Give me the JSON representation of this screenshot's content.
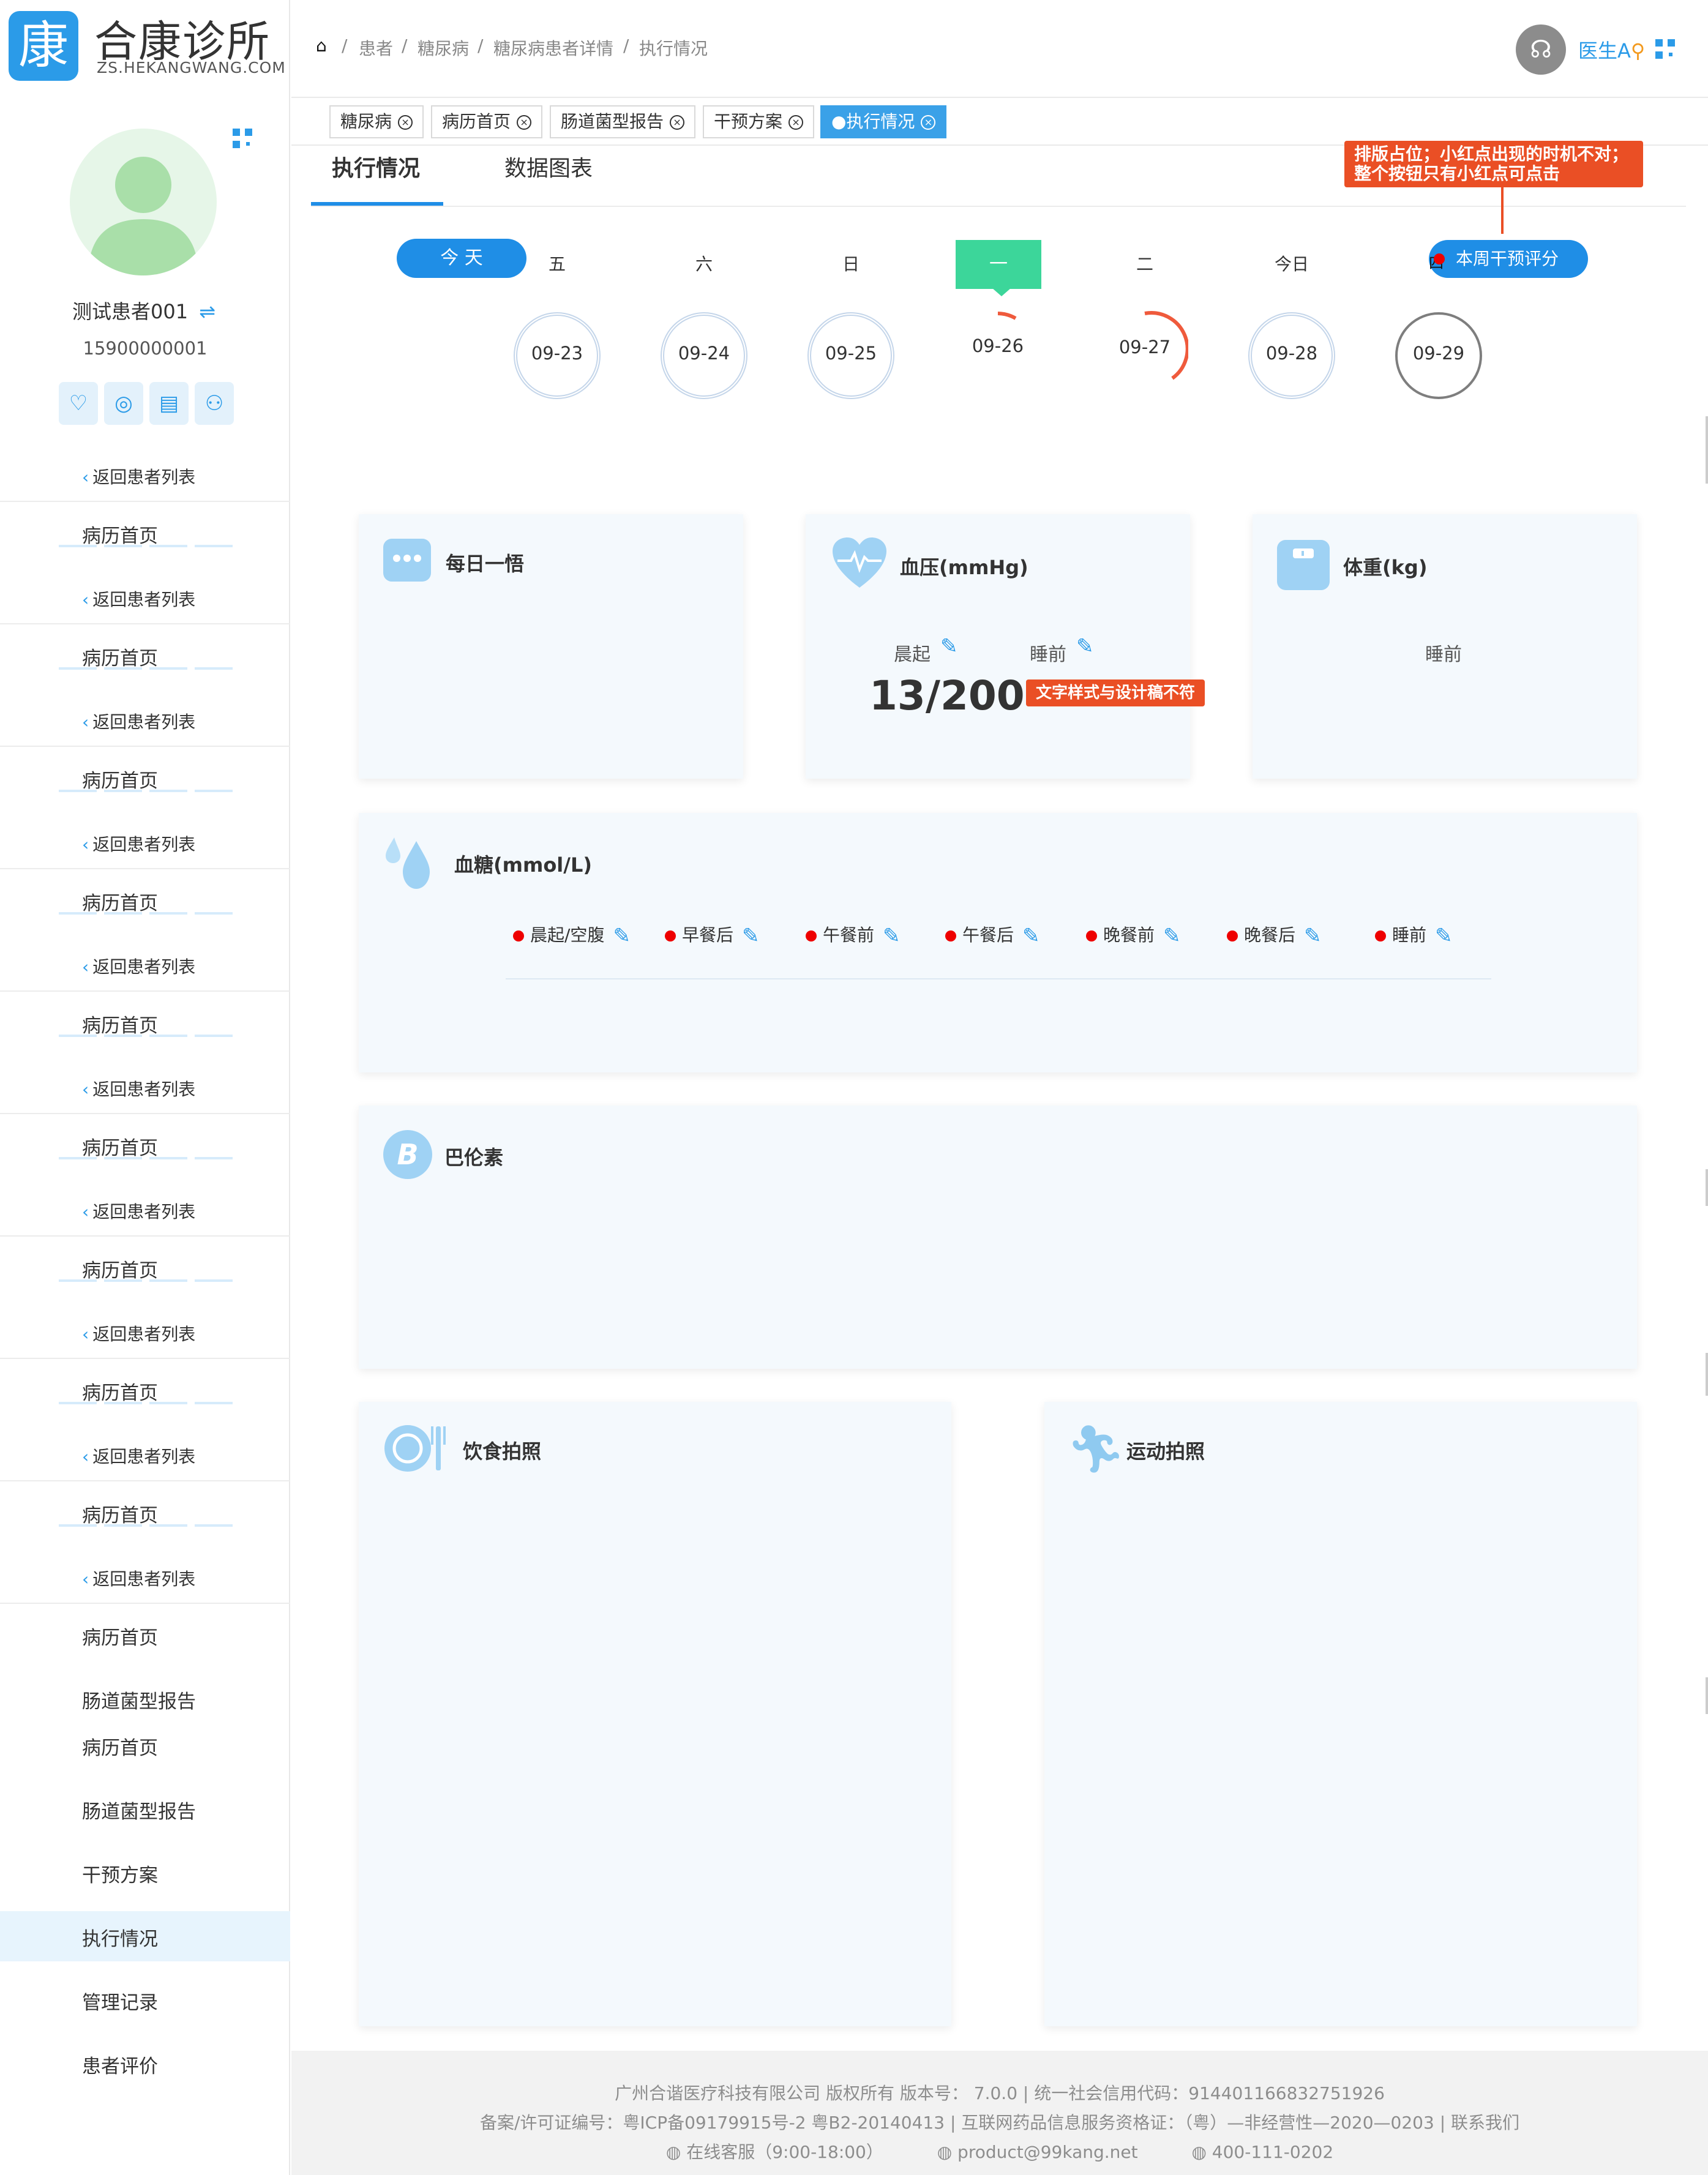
{
  "logo": {
    "glyph": "康",
    "name": "合康诊所",
    "sub": "ZS.HEKANGWANG.COM"
  },
  "patient": {
    "name": "测试患者001",
    "switch": "⇌",
    "phone": "15900000001"
  },
  "sidebar": {
    "back_label": "返回患者列表",
    "home_label": "病历首页",
    "menu": [
      "病历首页",
      "肠道菌型报告",
      "病历首页",
      "肠道菌型报告",
      "干预方案",
      "执行情况",
      "管理记录",
      "患者评价"
    ]
  },
  "breadcrumb": [
    "患者",
    "糖尿病",
    "糖尿病患者详情",
    "执行情况"
  ],
  "user": {
    "name": "医生A"
  },
  "tags": [
    {
      "label": "糖尿病"
    },
    {
      "label": "病历首页"
    },
    {
      "label": "肠道菌型报告"
    },
    {
      "label": "干预方案"
    },
    {
      "label": "●执行情况"
    }
  ],
  "tabs": [
    "执行情况",
    "数据图表"
  ],
  "week": {
    "today_btn": "今 天",
    "days": [
      "五",
      "六",
      "日",
      "一",
      "二",
      "今日"
    ],
    "dates": [
      "09-23",
      "09-24",
      "09-25",
      "09-26",
      "09-27",
      "09-28",
      "09-29"
    ],
    "score_btn": "本周干预评分",
    "score_char": "四"
  },
  "notes": {
    "layout": "排版占位；小红点出现的时机不对；\n整个按钮只有小红点可点击",
    "style": "文字样式与设计稿不符"
  },
  "cards": {
    "daily": "每日一悟",
    "bp": {
      "title": "血压(mmHg)",
      "morning": "晨起",
      "night": "睡前",
      "value": "13/200"
    },
    "weight": {
      "title": "体重(kg)",
      "night": "睡前"
    },
    "sugar": {
      "title": "血糖(mmol/L)",
      "items": [
        "晨起/空腹",
        "早餐后",
        "午餐前",
        "午餐后",
        "晚餐前",
        "晚餐后",
        "睡前"
      ]
    },
    "baron": {
      "title": "巴伦素"
    },
    "diet": {
      "title": "饮食拍照"
    },
    "sport": {
      "title": "运动拍照"
    }
  },
  "footer": {
    "line1": "广州合谐医疗科技有限公司 版权所有 版本号： 7.0.0 | 统一社会信用代码：914401166832751926",
    "line2": "备案/许可证编号：粤ICP备09179915号-2 粤B2-20140413 | 互联网药品信息服务资格证：（粤）—非经营性—2020—0203 | 联系我们",
    "service": "在线客服（9:00-18:00）",
    "email": "product@99kang.net",
    "phone": "400-111-0202"
  },
  "colors": {
    "primary": "#1f8ee6",
    "green": "#3cd69a",
    "note": "#ea4f25",
    "card_bg": "#f4f9fd"
  }
}
